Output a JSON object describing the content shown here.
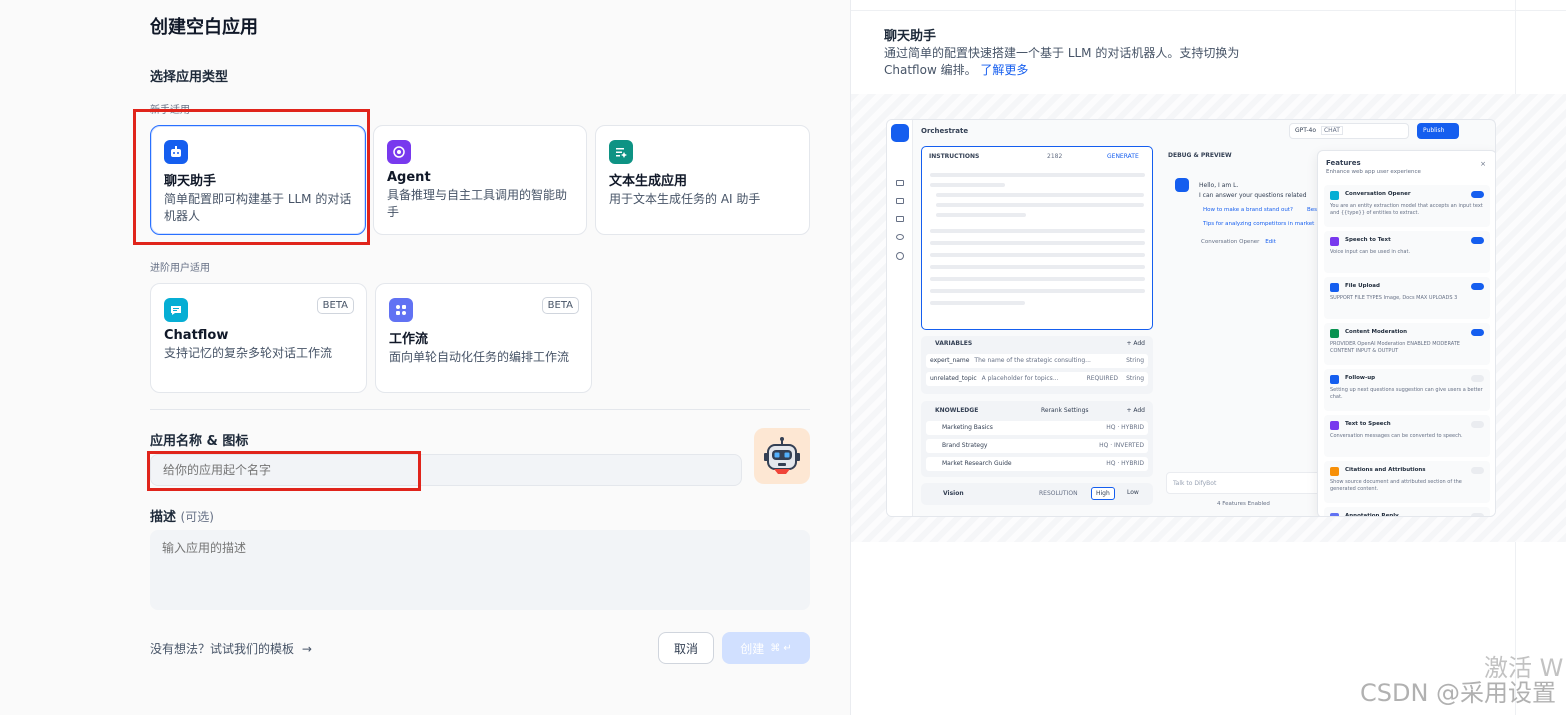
{
  "dialog": {
    "title": "创建空白应用",
    "section_label": "选择应用类型",
    "beginner_label": "新手适用",
    "advanced_label": "进阶用户适用"
  },
  "app_types": [
    {
      "name": "聊天助手",
      "desc": "简单配置即可构建基于 LLM 的对话机器人",
      "icon": "chatbot-icon",
      "color": "#155eef"
    },
    {
      "name": "Agent",
      "desc": "具备推理与自主工具调用的智能助手",
      "icon": "agent-icon",
      "color": "#7839ee"
    },
    {
      "name": "文本生成应用",
      "desc": "用于文本生成任务的 AI 助手",
      "icon": "text-generator-icon",
      "color": "#0e9384"
    },
    {
      "name": "Chatflow",
      "desc": "支持记忆的复杂多轮对话工作流",
      "icon": "chatflow-icon",
      "color": "#06aed4",
      "badge": "BETA"
    },
    {
      "name": "工作流",
      "desc": "面向单轮自动化任务的编排工作流",
      "icon": "workflow-icon",
      "color": "#6172f3",
      "badge": "BETA"
    }
  ],
  "form": {
    "name_label": "应用名称 & 图标",
    "name_placeholder": "给你的应用起个名字",
    "desc_label": "描述",
    "desc_optional": "(可选)",
    "desc_placeholder": "输入应用的描述",
    "template_link": "没有想法？试试我们的模板",
    "cancel": "取消",
    "create": "创建"
  },
  "preview_info": {
    "title": "聊天助手",
    "desc": "通过简单的配置快速搭建一个基于 LLM 的对话机器人。支持切换为 Chatflow 编排。",
    "learn_more": "了解更多"
  },
  "preview": {
    "orchestrate": "Orchestrate",
    "model": "GPT-4o",
    "model_tag": "CHAT",
    "publish": "Publish",
    "instructions": "INSTRUCTIONS",
    "instructions_count": "2182",
    "generate": "GENERATE",
    "debug": "DEBUG & PREVIEW",
    "variables": "VARIABLES",
    "add": "+ Add",
    "variable_rows": [
      {
        "name": "expert_name",
        "desc": "The name of the strategic consulting...",
        "type": "String",
        "required": ""
      },
      {
        "name": "unrelated_topic",
        "desc": "A placeholder for topics...",
        "type": "String",
        "required": "REQUIRED"
      }
    ],
    "knowledge": "KNOWLEDGE",
    "rerank": "Rerank Settings",
    "knowledge_rows": [
      {
        "name": "Marketing Basics",
        "tag": "HQ · HYBRID"
      },
      {
        "name": "Brand Strategy",
        "tag": "HQ · INVERTED"
      },
      {
        "name": "Market Research Guide",
        "tag": "HQ · HYBRID"
      }
    ],
    "vision": "Vision",
    "resolution": "RESOLUTION",
    "high": "High",
    "low": "Low",
    "greeting1": "Hello, I am L.",
    "greeting2": "I can answer your questions related",
    "suggest1": "How to make a brand stand out?",
    "suggest1b": "Bes",
    "suggest2": "Tips for analyzing competitors in market",
    "opener": "Conversation Opener",
    "edit": "Edit",
    "talk_placeholder": "Talk to DifyBot",
    "features_enabled": "4 Features Enabled",
    "features_title": "Features",
    "features_sub": "Enhance web app user experience",
    "features": [
      {
        "name": "Conversation Opener",
        "desc": "You are an entity extraction model that accepts an input text and {{type}} of entities to extract.",
        "on": true,
        "color": "#06aed4"
      },
      {
        "name": "Speech to Text",
        "desc": "Voice input can be used in chat.",
        "on": true,
        "color": "#7839ee"
      },
      {
        "name": "File Upload",
        "desc": "SUPPORT FILE TYPES  Image, Docs   MAX UPLOADS 3",
        "on": true,
        "color": "#155eef"
      },
      {
        "name": "Content Moderation",
        "desc": "PROVIDER OpenAI Moderation   ENABLED MODERATE CONTENT INPUT & OUTPUT",
        "on": true,
        "color": "#099250"
      },
      {
        "name": "Follow-up",
        "desc": "Setting up next questions suggestion can give users a better chat.",
        "on": false,
        "color": "#155eef"
      },
      {
        "name": "Text to Speech",
        "desc": "Conversation messages can be converted to speech.",
        "on": false,
        "color": "#7839ee"
      },
      {
        "name": "Citations and Attributions",
        "desc": "Show source document and attributed section of the generated content.",
        "on": false,
        "color": "#f79009"
      },
      {
        "name": "Annotation Reply",
        "desc": "",
        "on": false,
        "color": "#6172f3"
      }
    ]
  },
  "watermark": {
    "activate": "激活 W",
    "csdn": "CSDN @采用设置"
  }
}
